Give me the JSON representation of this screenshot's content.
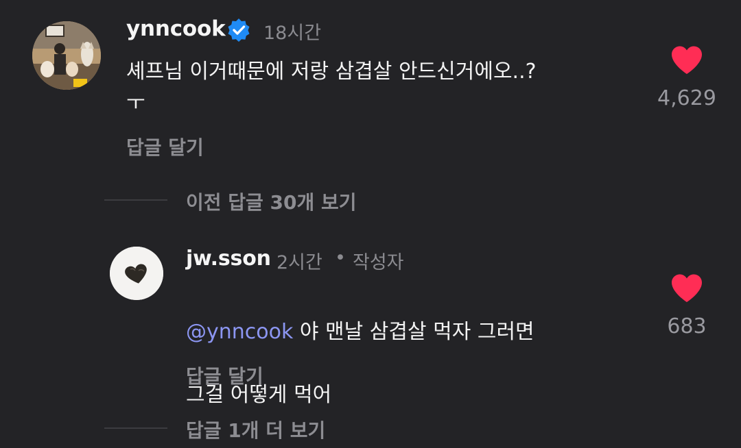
{
  "comment": {
    "username": "ynncook",
    "time": "18시간",
    "text": "셰프님 이거때문에 저랑 삼겹살 안드신거에오..?\nㅜ",
    "likes": "4,629",
    "reply_label": "답글 달기",
    "more_replies_label": "이전 답글 30개 보기"
  },
  "reply": {
    "username": "jw.sson",
    "time": "2시간",
    "separator": "•",
    "author_tag": "작성자",
    "mention": "@ynncook",
    "text_line1": " 야 맨날 삼겹살 먹자 그러면",
    "text_line2": "그걸 어떻게 먹어",
    "likes": "683",
    "reply_label": "답글 달기",
    "more_replies_label": "답글 1개 더 보기"
  },
  "colors": {
    "background": "#232326",
    "like_heart": "#ff2d55",
    "verified_badge": "#1f8bf5",
    "mention": "#8c96f2"
  },
  "icons": {
    "verified": "verified-badge-icon",
    "like": "heart-icon"
  }
}
